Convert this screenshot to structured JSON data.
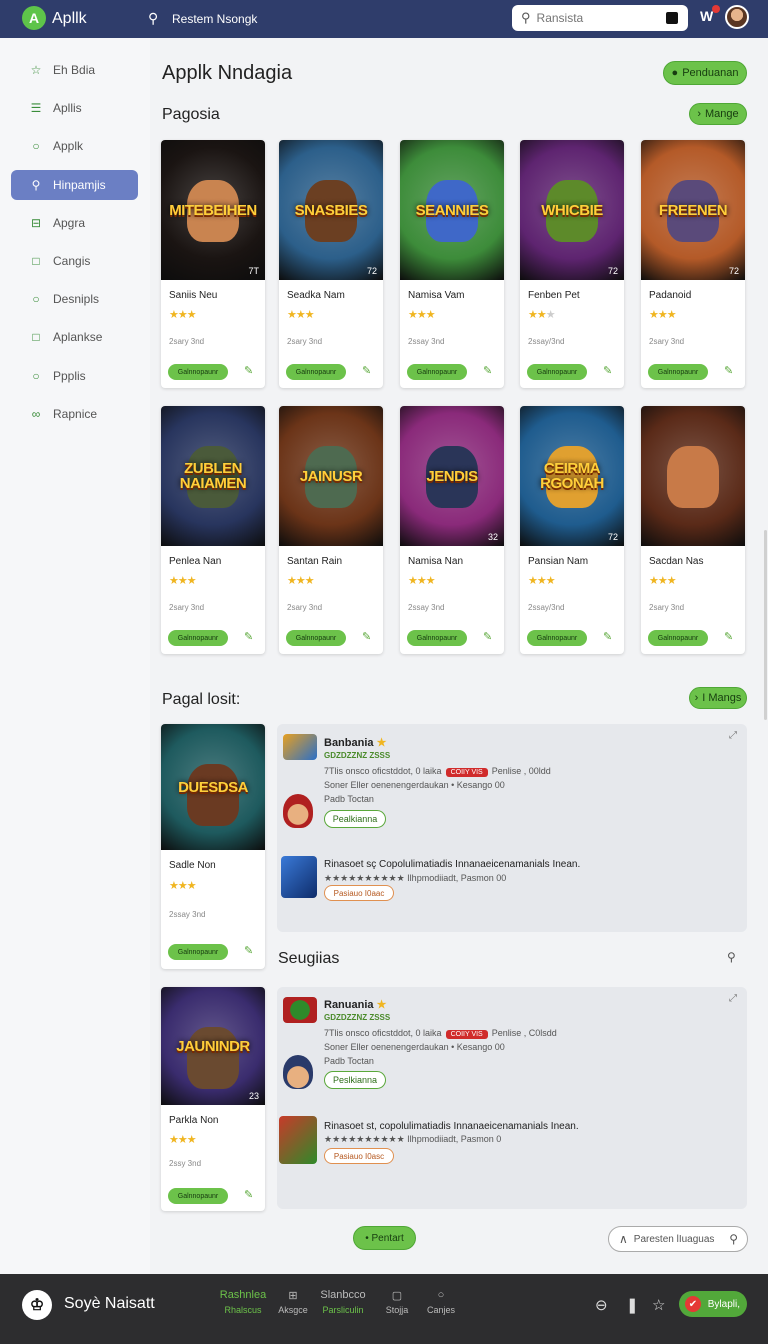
{
  "header": {
    "logo_text": "A",
    "app_name": "Apllk",
    "top_search_label": "Restem Nsongk",
    "search_placeholder": "Ransista"
  },
  "sidebar": {
    "items": [
      {
        "label": "Eh Bdia",
        "icon": "star-icon"
      },
      {
        "label": "Apllis",
        "icon": "list-icon"
      },
      {
        "label": "Applk",
        "icon": "chat-icon"
      },
      {
        "label": "Hinpamjis",
        "icon": "search-icon",
        "active": true
      },
      {
        "label": "Apgra",
        "icon": "minus-square-icon"
      },
      {
        "label": "Cangis",
        "icon": "square-icon"
      },
      {
        "label": "Desnipls",
        "icon": "chat-icon"
      },
      {
        "label": "Aplankse",
        "icon": "square-icon"
      },
      {
        "label": "Ppplis",
        "icon": "circle-icon"
      },
      {
        "label": "Rapnice",
        "icon": "infinity-icon"
      }
    ]
  },
  "main": {
    "title": "Applk Nndagia",
    "header_button": "Penduanan",
    "section1": {
      "title": "Pagosia",
      "more": "Mange"
    },
    "row1": [
      {
        "title_art": "MITEBEIHEN",
        "name": "Saniis Neu",
        "stars": 3,
        "size": "2sary 3nd",
        "get": "Galnnopaunr",
        "bg": "#1a1412",
        "hero": "#c98450",
        "corner": "7T"
      },
      {
        "title_art": "SNASBIES",
        "name": "Seadka Nam",
        "stars": 3,
        "size": "2sary 3nd",
        "get": "Galnnopaunr",
        "bg": "#2c5f8a",
        "hero": "#6b3f22",
        "corner": "72"
      },
      {
        "title_art": "SEANNIES",
        "name": "Namisa Vam",
        "stars": 3,
        "size": "2ssay 3nd",
        "get": "Galnnopaunr",
        "bg": "#3d8c3a",
        "hero": "#3f68c8",
        "corner": ""
      },
      {
        "title_art": "WHICBIE",
        "name": "Fenben Pet",
        "stars": 2,
        "size": "2ssay/3nd",
        "get": "Galnnopaunr",
        "bg": "#5e2470",
        "hero": "#5d8a2a",
        "corner": "72"
      },
      {
        "title_art": "FREENEN",
        "name": "Padanoid",
        "stars": 3,
        "size": "2sary 3nd",
        "get": "Galnnopaunr",
        "bg": "#b45a28",
        "hero": "#5a4a7a",
        "corner": "72"
      }
    ],
    "row2": [
      {
        "title_art": "ZUBLEN NAIAMEN",
        "name": "Penlea Nan",
        "stars": 3,
        "size": "2sary 3nd",
        "get": "Galnnopaunr",
        "bg": "#28355e",
        "hero": "#4a5a3a",
        "corner": ""
      },
      {
        "title_art": "JAINUSR",
        "name": "Santan Rain",
        "stars": 3,
        "size": "2sary 3nd",
        "get": "Galnnopaunr",
        "bg": "#6b3418",
        "hero": "#4e6a50",
        "corner": ""
      },
      {
        "title_art": "JENDIS",
        "name": "Namisa Nan",
        "stars": 3,
        "size": "2ssay 3nd",
        "get": "Galnnopaunr",
        "bg": "#8a2a7a",
        "hero": "#2a3558",
        "corner": "32"
      },
      {
        "title_art": "CEIRMA RGONAH",
        "name": "Pansian Nam",
        "stars": 3,
        "size": "2ssay/3nd",
        "get": "Galnnopaunr",
        "bg": "#1f5c8e",
        "hero": "#e0a030",
        "corner": "72"
      },
      {
        "title_art": "",
        "name": "Sacdan Nas",
        "stars": 3,
        "size": "2sary 3nd",
        "get": "Galnnopaunr",
        "bg": "#5a2a18",
        "hero": "#c87a48",
        "corner": ""
      }
    ],
    "section2": {
      "title": "Pagal losit:",
      "more": "I Mangs"
    },
    "card3": {
      "title_art": "DUESDSA",
      "name": "Sadle Non",
      "stars": 3,
      "size": "2ssay 3nd",
      "get": "Galnnopaunr",
      "bg": "#1e5a5e",
      "hero": "#6a3a22"
    },
    "feat1": {
      "title": "Banbania",
      "sub": "GDZDZZNZ ZSSS",
      "line1a": "7Tlis onsco oficstddot,  0 laika",
      "badge": "COIIY VIS",
      "line1b": "Penlise , 00ldd",
      "line2": "Soner Eller oenenengerdaukan  •  Kesango  00",
      "line3": "Padb Toctan",
      "outline_btn": "Pealkianna",
      "app_title": "Rinasoet sç Copolulimatiadis  Innanaeicenamanials Inean.",
      "app_line": "★★★★★★★★★★ Ilhpmodiiadt,  Pasmon  00",
      "app_btn": "Pasiauo I0aac"
    },
    "section3": {
      "title": "Seugiias"
    },
    "card4": {
      "title_art": "JAUNINDR",
      "name": "Parkla Non",
      "stars": 3,
      "size": "2ssy 3nd",
      "get": "Galnnopaunr",
      "bg": "#3a2c6e",
      "hero": "#6a4a30",
      "corner": "23"
    },
    "feat2": {
      "title": "Ranuania",
      "sub": "GDZDZZNZ ZSSS",
      "line1a": "7Tlis onsco oficstddot,  0 laika",
      "badge": "COIIY VIS",
      "line1b": "Penlise , C0lsdd",
      "line2": "Soner Eller oenenengerdaukan  •  Kesango  00",
      "line3": "Padb Toctan",
      "outline_btn": "Peslkianna",
      "app_title": "Rinasoet st, copolulimatiadis  Innanaeicenamanials Inean.",
      "app_line": "★★★★★★★★★★ Ilhpmodiiadt,  Pasmon  0",
      "app_btn": "Pasiauo I0asc"
    },
    "bottom_pill": "Pentart",
    "bottom_search": "Paresten lIuaguas"
  },
  "bottombar": {
    "brand": "Soyè Naisatt",
    "tabs": [
      {
        "t1": "Rashnlea",
        "t2": "Rhalscus",
        "active": true
      },
      {
        "t1": "⊞",
        "t2": "Aksgce"
      },
      {
        "t1": "Slanbcco",
        "t2": "Parsliculin",
        "active2": true
      },
      {
        "t1": "▢",
        "t2": "Stojja"
      },
      {
        "t1": "○",
        "t2": "Canjes"
      }
    ],
    "cta": "Bylapli,"
  }
}
